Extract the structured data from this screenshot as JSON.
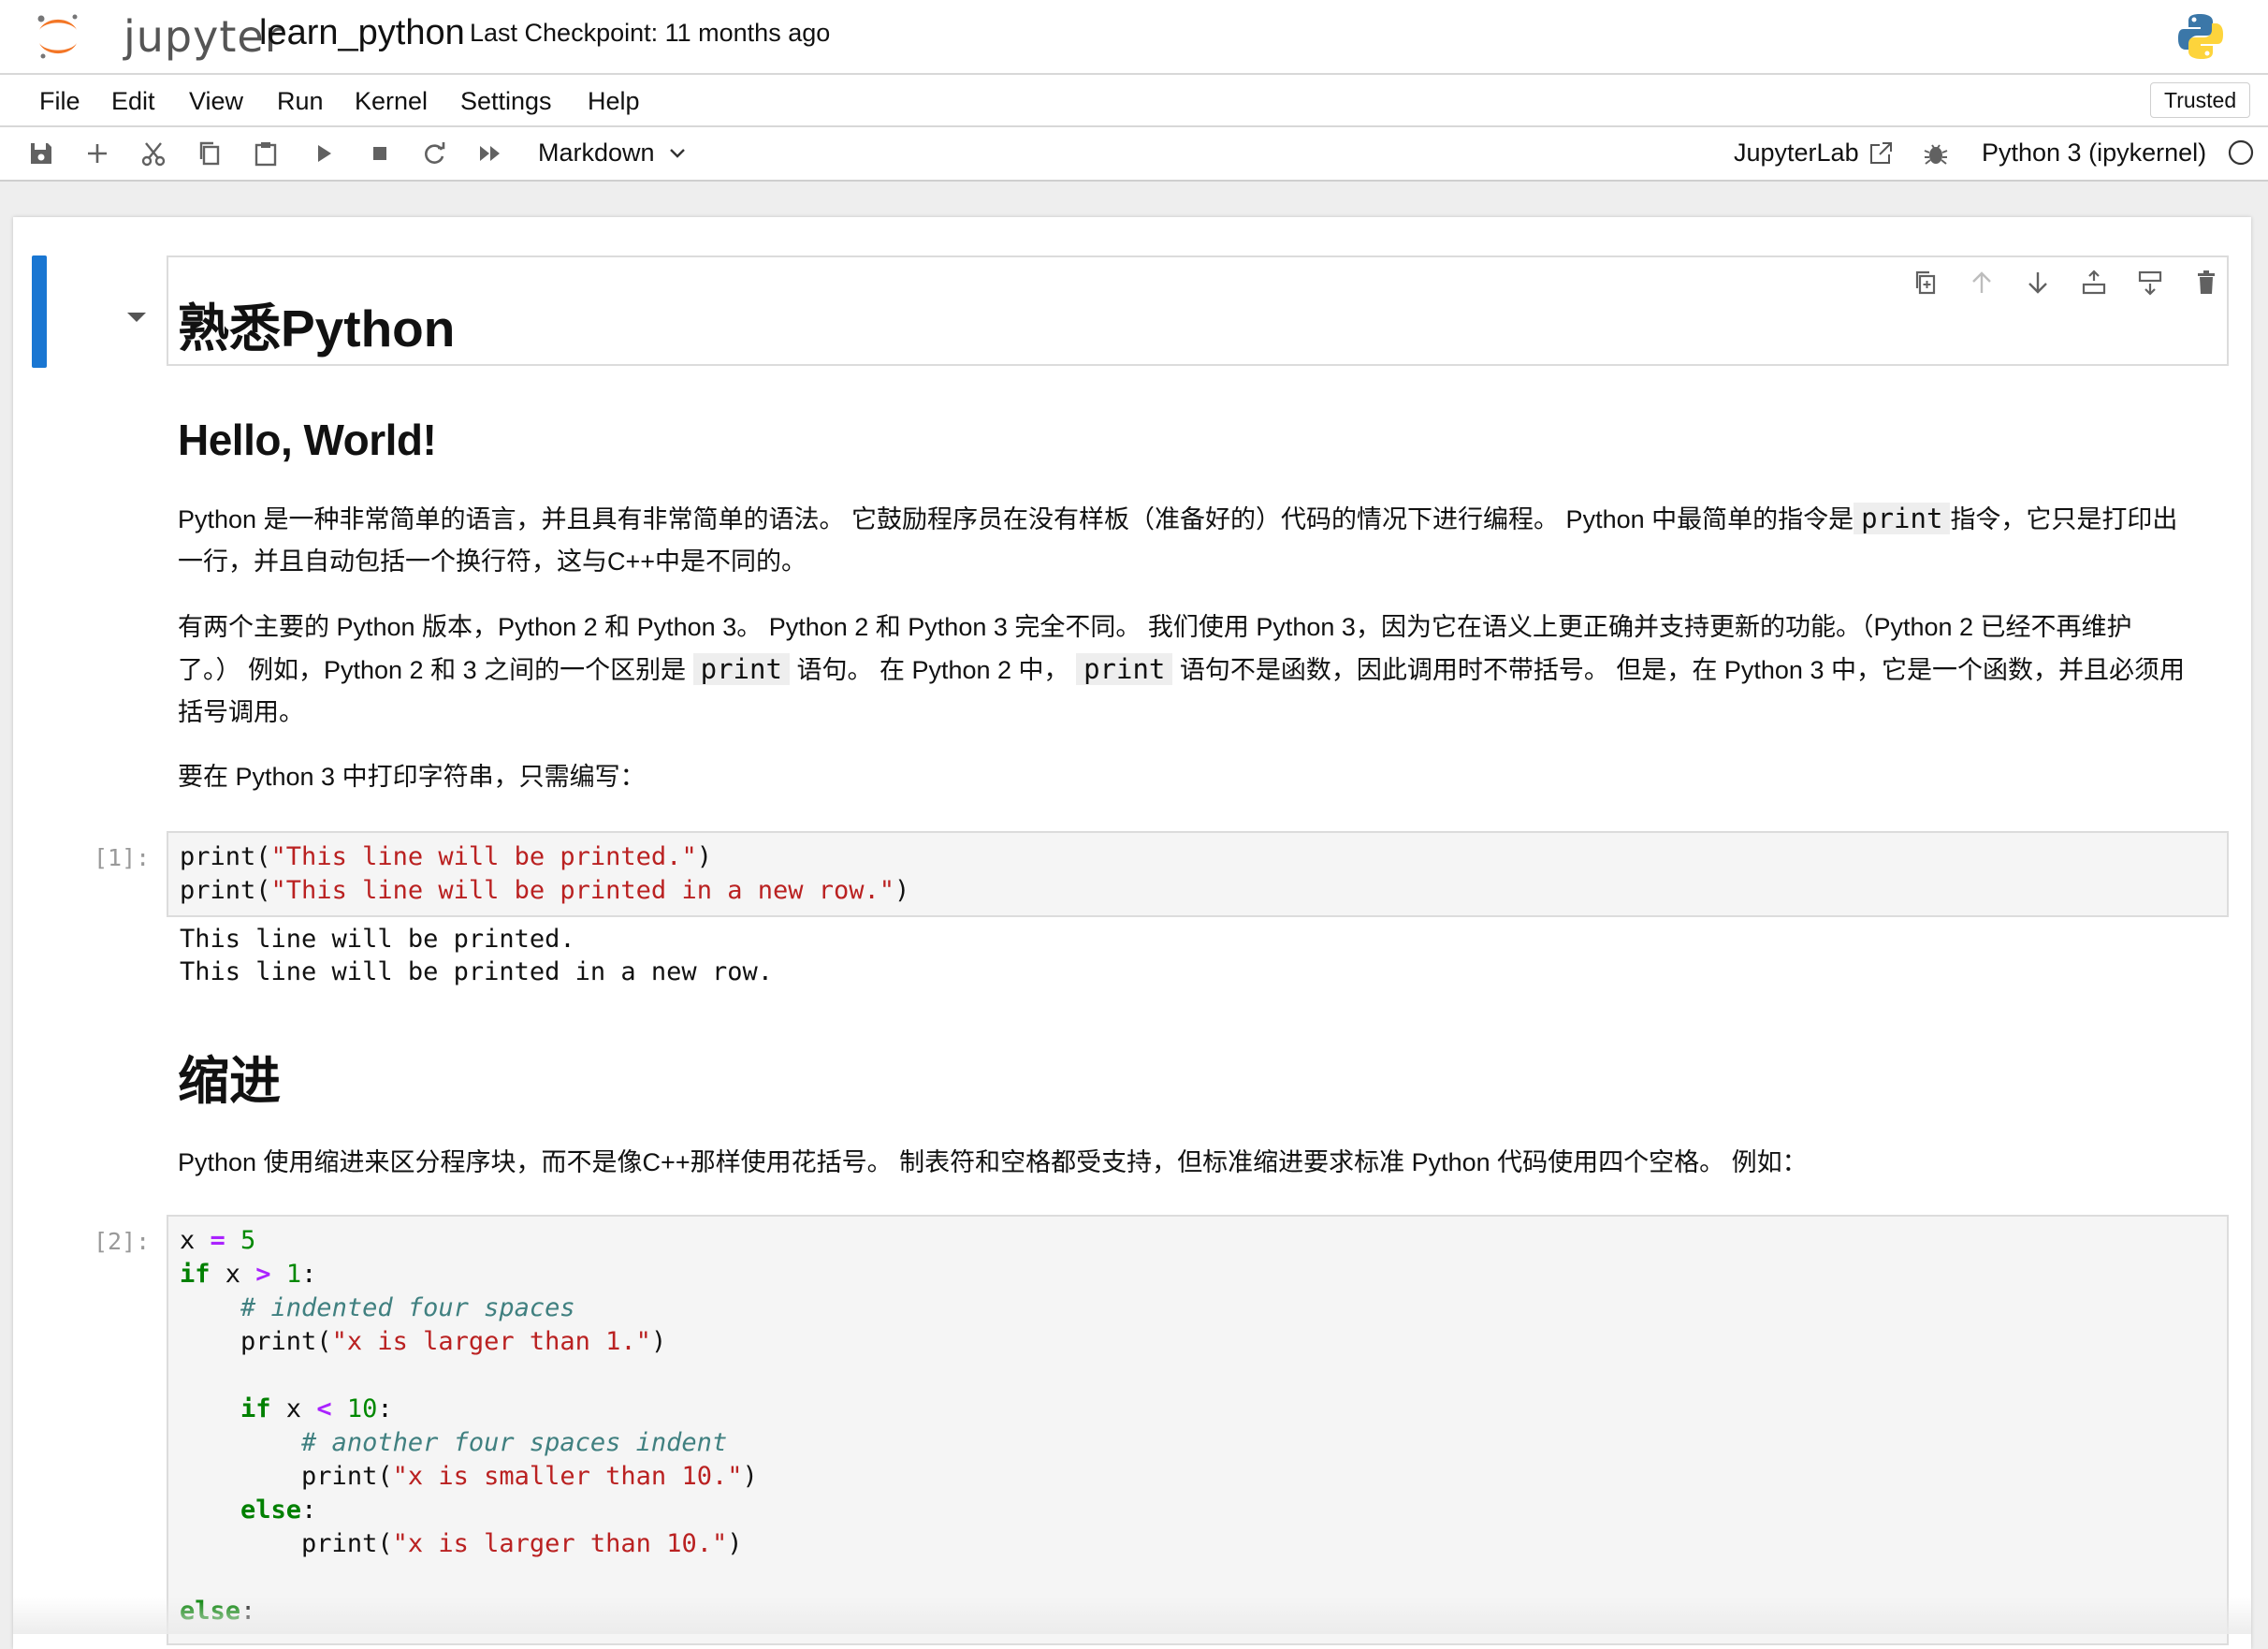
{
  "header": {
    "logo_text": "jupyter",
    "notebook_title": "learn_python",
    "checkpoint": "Last Checkpoint: 11 months ago"
  },
  "menu": {
    "items": [
      "File",
      "Edit",
      "View",
      "Run",
      "Kernel",
      "Settings",
      "Help"
    ],
    "trusted": "Trusted"
  },
  "toolbar": {
    "icons": [
      "save-icon",
      "add-icon",
      "cut-icon",
      "copy-icon",
      "paste-icon",
      "run-icon",
      "stop-icon",
      "restart-icon",
      "fast-forward-icon"
    ],
    "cell_type": "Markdown",
    "jupyterlab": "JupyterLab",
    "kernel_name": "Python 3 (ipykernel)"
  },
  "cell_toolbar": {
    "icons": [
      "duplicate-icon",
      "move-up-icon",
      "move-down-icon",
      "insert-above-icon",
      "insert-below-icon",
      "delete-icon"
    ]
  },
  "notebook": {
    "h1": "熟悉Python",
    "h2": "Hello, World!",
    "para1_a": "Python 是一种非常简单的语言，并且具有非常简单的语法。 它鼓励程序员在没有样板（准备好的）代码的情况下进行编程。 Python 中最简单的指令是",
    "para1_code": "print",
    "para1_b": "指令，它只是打印出一行，并且自动包括一个换行符，这与C++中是不同的。",
    "para2_a": "有两个主要的 Python 版本，Python 2 和 Python 3。 Python 2 和 Python 3 完全不同。 我们使用 Python 3，因为它在语义上更正确并支持更新的功能。（Python 2 已经不再维护了。） 例如，Python 2 和 3 之间的一个区别是",
    "para2_code1": "print",
    "para2_b": "语句。 在 Python 2 中，",
    "para2_code2": "print",
    "para2_c": "语句不是函数，因此调用时不带括号。 但是，在 Python 3 中，它是一个函数，并且必须用括号调用。",
    "para3": "要在 Python 3 中打印字符串，只需编写：",
    "cell1_prompt": "[1]:",
    "cell1_line1_fn": "print(",
    "cell1_line1_str": "\"This line will be printed.\"",
    "cell1_line2_str": "\"This line will be printed in a new row.\"",
    "cell1_close": ")",
    "output1_line1": "This line will be printed.",
    "output1_line2": "This line will be printed in a new row.",
    "h2b": "缩进",
    "para4": "Python 使用缩进来区分程序块，而不是像C++那样使用花括号。 制表符和空格都受支持，但标准缩进要求标准 Python 代码使用四个空格。 例如：",
    "cell2_prompt": "[2]:",
    "cell2": {
      "l1_var": "x ",
      "l1_op": "=",
      "l1_num": " 5",
      "l2_kw": "if",
      "l2_var": " x ",
      "l2_op": ">",
      "l2_num": " 1",
      "colon": ":",
      "l3_comment": "# indented four spaces",
      "l4_fn": "print(",
      "l4_str": "\"x is larger than 1.\"",
      "l6_kw": "if",
      "l6_var": " x ",
      "l6_op": "<",
      "l6_num": " 10",
      "l7_comment": "# another four spaces indent",
      "l8_str": "\"x is smaller than 10.\"",
      "l9_kw": "else",
      "l10_str": "\"x is larger than 10.\"",
      "l12_kw": "else"
    }
  }
}
